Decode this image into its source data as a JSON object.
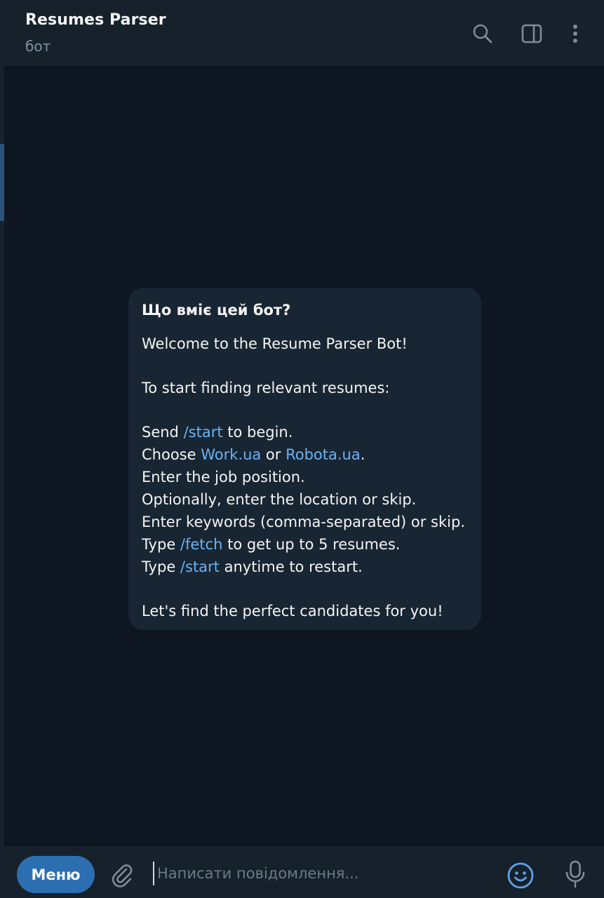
{
  "header": {
    "title": "Resumes Parser",
    "subtitle": "бот",
    "icons": [
      "search-icon",
      "side-panel-icon",
      "more-vertical-icon"
    ]
  },
  "message": {
    "heading": "Що вміє цей бот?",
    "welcome": "Welcome to the Resume Parser Bot!",
    "intro": "To start finding relevant resumes:",
    "steps": {
      "send_prefix": "Send ",
      "send_cmd": "/start",
      "send_suffix": " to begin.",
      "choose_prefix": "Choose ",
      "choose_link1": "Work.ua",
      "choose_mid": " or ",
      "choose_link2": "Robota.ua",
      "choose_suffix": ".",
      "position": "Enter the job position.",
      "location": "Optionally, enter the location or skip.",
      "keywords": "Enter keywords (comma-separated) or skip.",
      "fetch_prefix": "Type ",
      "fetch_cmd": "/fetch",
      "fetch_suffix": " to get up to 5 resumes.",
      "restart_prefix": "Type ",
      "restart_cmd": "/start",
      "restart_suffix": " anytime to restart."
    },
    "closing": "Let's find the perfect candidates for you!"
  },
  "composer": {
    "menu_label": "Меню",
    "placeholder": "Написати повідомлення...",
    "icons": [
      "attach-icon",
      "emoji-icon",
      "microphone-icon"
    ]
  },
  "colors": {
    "background": "#0e1621",
    "panel": "#17212b",
    "bubble": "#182533",
    "link": "#6ab3f3",
    "menu_button": "#2b6fb0"
  }
}
